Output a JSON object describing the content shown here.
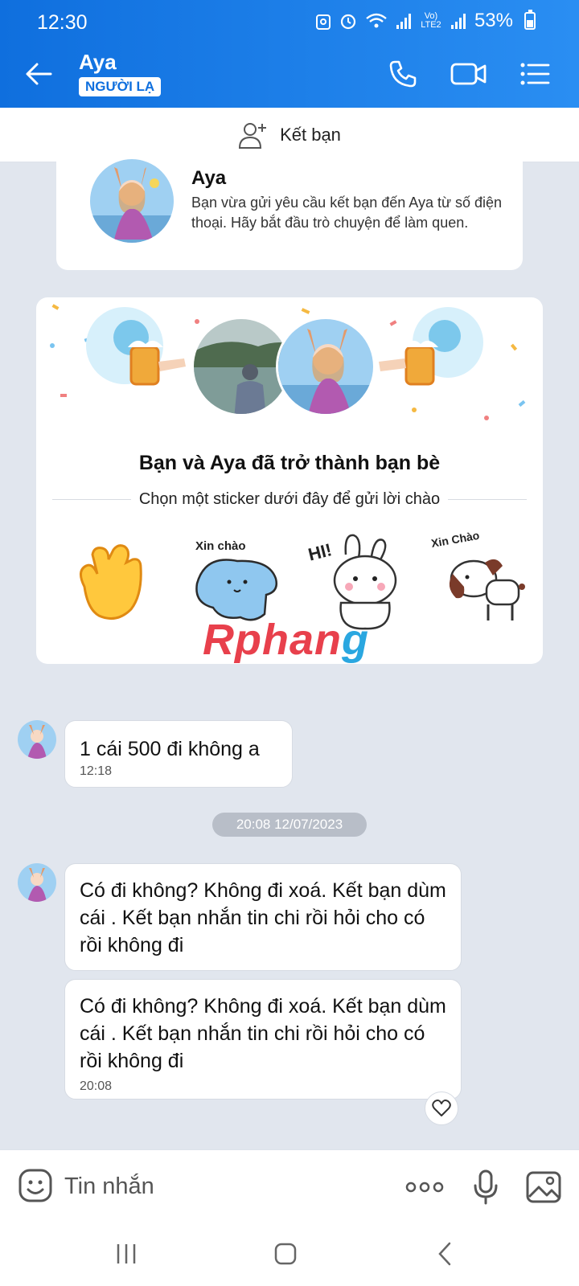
{
  "status_bar": {
    "time": "12:30",
    "network": "Vo) LTE2",
    "battery": "53%"
  },
  "header": {
    "contact_name": "Aya",
    "badge": "NGƯỜI LẠ"
  },
  "add_friend": {
    "label": "Kết bạn"
  },
  "intro": {
    "name": "Aya",
    "text": "Bạn vừa gửi yêu cầu kết bạn đến Aya từ số điện thoại. Hãy bắt đầu trò chuyện để làm quen."
  },
  "friend_card": {
    "title": "Bạn và Aya đã trở thành bạn bè",
    "subtitle": "Chọn một sticker dưới đây để gửi lời chào",
    "stickers": [
      {
        "icon": "waving-hand-sticker"
      },
      {
        "icon": "blue-cat-sticker",
        "text": "Xin chào"
      },
      {
        "icon": "bunny-sticker",
        "text": "HI!"
      },
      {
        "icon": "dog-sticker",
        "text": "Xin Chào"
      }
    ],
    "watermark_main": "Rphan",
    "watermark_tail": "g"
  },
  "messages": [
    {
      "text": "1 cái 500 đi không a",
      "time": "12:18"
    },
    {
      "text": "Có đi không? Không đi xoá. Kết bạn dùm cái . Kết bạn nhắn tin chi rồi hỏi cho có rồi không đi"
    },
    {
      "text": "Có đi không? Không đi xoá. Kết bạn dùm cái . Kết bạn nhắn tin chi rồi hỏi cho có rồi không đi",
      "time": "20:08"
    }
  ],
  "date_separator": "20:08 12/07/2023",
  "input": {
    "placeholder": "Tin nhắn"
  },
  "colors": {
    "header_blue": "#0f6fde",
    "accent_blue": "#2a8ef2",
    "background": "#e1e6ee"
  }
}
